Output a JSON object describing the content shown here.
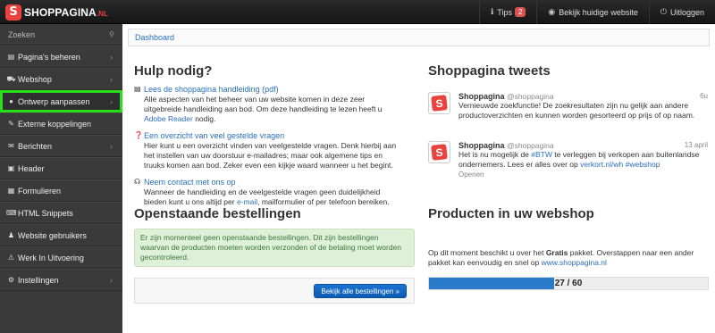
{
  "app": {
    "logo_letter": "S",
    "logo_name": "SHOPPAGINA",
    "logo_tld": ".NL",
    "brand_color": "#e8433e"
  },
  "topnav": {
    "tips_label": "Tips",
    "tips_count": "2",
    "view_site_label": "Bekijk huidige website",
    "logout_label": "Uitloggen"
  },
  "sidebar": {
    "search_placeholder": "Zoeken",
    "items": [
      {
        "label": "Pagina's beheren",
        "icon": "page-icon",
        "chevron": true
      },
      {
        "label": "Webshop",
        "icon": "cart-icon",
        "chevron": true
      },
      {
        "label": "Ontwerp aanpassen",
        "icon": "drop-icon",
        "chevron": true,
        "active": true
      },
      {
        "label": "Externe koppelingen",
        "icon": "pencil-icon",
        "chevron": false
      },
      {
        "label": "Berichten",
        "icon": "envelope-icon",
        "chevron": true
      },
      {
        "label": "Header",
        "icon": "image-icon",
        "chevron": false
      },
      {
        "label": "Formulieren",
        "icon": "form-icon",
        "chevron": false
      },
      {
        "label": "HTML Snippets",
        "icon": "code-icon",
        "chevron": false
      },
      {
        "label": "Website gebruikers",
        "icon": "user-icon",
        "chevron": false
      },
      {
        "label": "Werk In Uitvoering",
        "icon": "warning-icon",
        "chevron": false
      },
      {
        "label": "Instellingen",
        "icon": "gear-icon",
        "chevron": true
      }
    ]
  },
  "breadcrumb": {
    "label": "Dashboard"
  },
  "help": {
    "title": "Hulp nodig?",
    "items": [
      {
        "link": "Lees de shoppagina handleiding (pdf)",
        "desc_before": "Alle aspecten van het beheer van uw website komen in deze zeer uitgebreide handleiding aan bod. Om deze handleiding te lezen heeft u ",
        "desc_link": "Adobe Reader",
        "desc_after": " nodig."
      },
      {
        "link": "Een overzicht van veel gestelde vragen",
        "desc_before": "Hier kunt u een overzicht vinden van veelgestelde vragen. Denk hierbij aan het instellen van uw doorstuur e-mailadres; maar ook algemene tips en truuks komen aan bod. Zeker even een kijkje waard wanneer u het begint.",
        "desc_link": "",
        "desc_after": ""
      },
      {
        "link": "Neem contact met ons op",
        "desc_before": "Wanneer de handleiding en de veelgestelde vragen geen duidelijkheid bieden kunt u ons altijd per ",
        "desc_link": "e-mail",
        "desc_after": ", mailformulier of per telefoon bereiken."
      }
    ]
  },
  "orders": {
    "title": "Openstaande bestellingen",
    "alert": "Er zijn momenteel geen openstaande bestellingen. Dit zijn bestellingen waarvan de producten moeten worden verzonden of de betaling moet worden gecontroleerd.",
    "button": "Bekijk alle bestellingen »"
  },
  "tweets": {
    "title": "Shoppagina tweets",
    "items": [
      {
        "name": "Shoppagina",
        "handle": "@shoppagina",
        "time": "6u",
        "text": "Vernieuwde zoekfunctie! De zoekresultaten zijn nu gelijk aan andere productoverzichten en kunnen worden gesorteerd op prijs of op naam.",
        "open": ""
      },
      {
        "name": "Shoppagina",
        "handle": "@shoppagina",
        "time": "13 april",
        "text_before": "Het is nu mogelijk de ",
        "hashtag1": "#BTW",
        "text_mid": " te verleggen bij verkopen aan buitenlandse ondernemers. Lees er alles over op ",
        "link": "verkort.nl/wh",
        "hashtag2": "#webshop",
        "open": "Openen"
      }
    ]
  },
  "products": {
    "title": "Producten in uw webshop",
    "text_before": "Op dit moment beschikt u over het ",
    "plan": "Gratis",
    "text_mid": " pakket. Overstappen naar een ander pakket kan eenvoudig en snel op ",
    "link": "www.shoppagina.nl",
    "used": 27,
    "max": 60,
    "label": "27 / 60"
  }
}
